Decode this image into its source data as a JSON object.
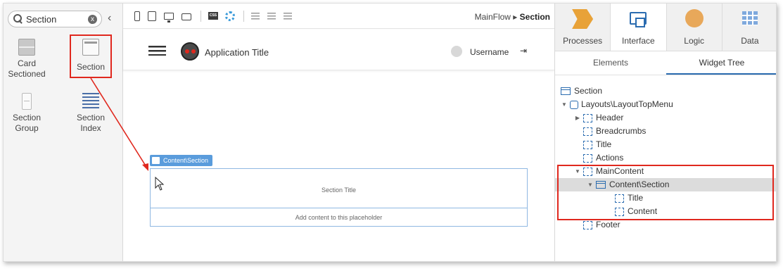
{
  "toolbox": {
    "search_value": "Section",
    "clear_icon": "x",
    "collapse_icon": "chevron-left-icon",
    "widgets": [
      {
        "label": "Card\nSectioned",
        "icon": "card-sectioned-icon"
      },
      {
        "label": "Section",
        "icon": "section-icon"
      },
      {
        "label": "Section\nGroup",
        "icon": "section-group-icon"
      },
      {
        "label": "Section\nIndex",
        "icon": "section-index-icon"
      }
    ]
  },
  "canvas": {
    "flow_breadcrumb": "MainFlow ▸ ",
    "screen_name": "Section",
    "app_title": "Application Title",
    "username": "Username",
    "logout_icon": "⇥",
    "section_tag": "Content\\Section",
    "section_title": "Section Title",
    "section_content_placeholder": "Add content to this placeholder"
  },
  "right_panel": {
    "tabs": [
      {
        "label": "Processes",
        "icon": "processes-icon"
      },
      {
        "label": "Interface",
        "icon": "interface-icon",
        "active": true
      },
      {
        "label": "Logic",
        "icon": "logic-icon"
      },
      {
        "label": "Data",
        "icon": "data-icon"
      }
    ],
    "subtabs": [
      {
        "label": "Elements"
      },
      {
        "label": "Widget Tree",
        "active": true
      }
    ],
    "tree": [
      {
        "label": "Section"
      },
      {
        "label": "Layouts\\LayoutTopMenu"
      },
      {
        "label": "Header"
      },
      {
        "label": "Breadcrumbs"
      },
      {
        "label": "Title"
      },
      {
        "label": "Actions"
      },
      {
        "label": "MainContent"
      },
      {
        "label": "Content\\Section"
      },
      {
        "label": "Title"
      },
      {
        "label": "Content"
      },
      {
        "label": "Footer"
      }
    ]
  },
  "colors": {
    "annotation_red": "#e0281e",
    "accent_blue": "#2b6cb0",
    "section_blue": "#5a9cdc"
  }
}
